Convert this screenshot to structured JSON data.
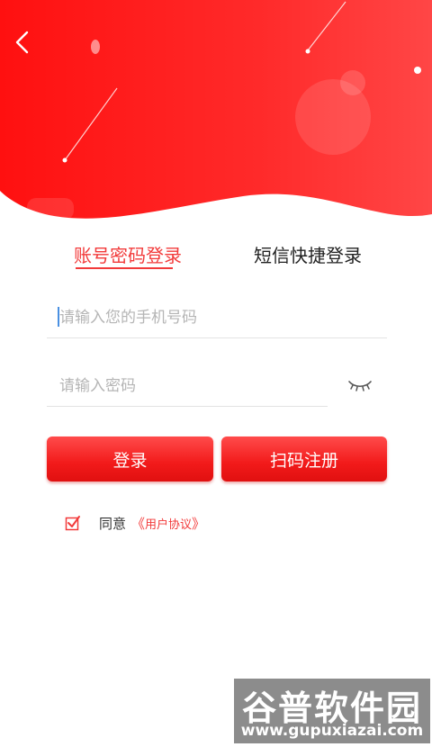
{
  "colors": {
    "brand": "#f23a3a",
    "header_red": "#ff1a1a",
    "header_light": "#ff5a5a"
  },
  "header": {
    "back_icon": "chevron-left-icon"
  },
  "tabs": [
    {
      "label": "账号密码登录",
      "active": true
    },
    {
      "label": "短信快捷登录",
      "active": false
    }
  ],
  "form": {
    "phone_placeholder": "请输入您的手机号码",
    "password_placeholder": "请输入密码",
    "password_toggle_icon": "eye-closed-icon"
  },
  "buttons": {
    "login_label": "登录",
    "register_label": "扫码注册"
  },
  "agreement": {
    "checked": true,
    "prefix": "同意",
    "open_bracket": "《",
    "link_label": "用户协议",
    "close_bracket": "》"
  },
  "watermark": {
    "title": "谷普软件园",
    "url": "www.gupuxiazai.com"
  }
}
